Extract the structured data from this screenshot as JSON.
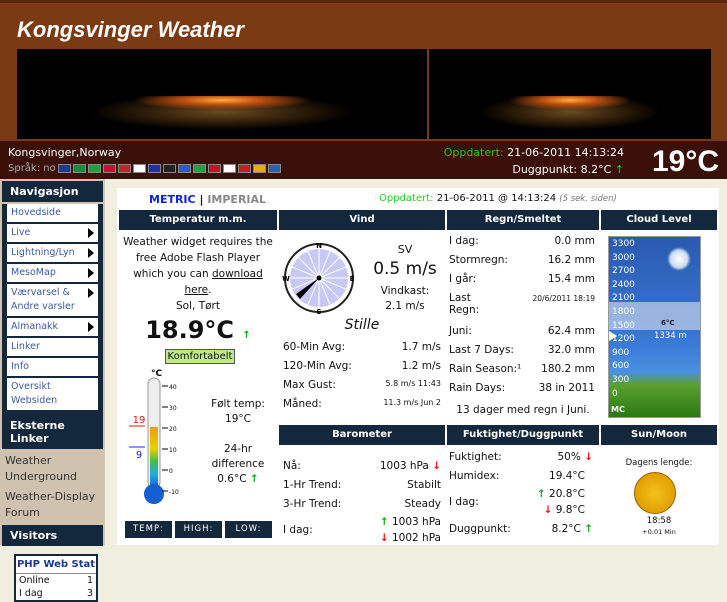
{
  "header": {
    "title": "Kongsvinger Weather",
    "location": "Kongsvinger,Norway",
    "language_label": "Språk: no",
    "updated_label": "Oppdatert:",
    "updated_value": "21-06-2011  14:13:24",
    "dewpoint_label": "Duggpunkt:",
    "dewpoint_value": "8.2°C",
    "big_temp": "19°C",
    "flags": [
      "gb",
      "za",
      "bg",
      "dk",
      "nl",
      "fi",
      "fr",
      "de",
      "gr",
      "it",
      "no",
      "pl",
      "pt",
      "es",
      "se"
    ]
  },
  "sidebar": {
    "nav_title": "Navigasjon",
    "items": [
      {
        "label": "Hovedside",
        "sub": false
      },
      {
        "label": "Live",
        "sub": true
      },
      {
        "label": "Lightning/Lyn",
        "sub": true
      },
      {
        "label": "MesoMap",
        "sub": true
      },
      {
        "label": "Værvarsel & Andre varsler",
        "sub": true
      },
      {
        "label": "Almanakk",
        "sub": true
      },
      {
        "label": "Linker",
        "sub": false
      },
      {
        "label": "Info",
        "sub": false
      },
      {
        "label": "Oversikt Websiden",
        "sub": false
      }
    ],
    "ext_title": "Eksterne Linker",
    "ext_links": [
      "Weather Underground",
      "Weather-Display Forum"
    ],
    "visitors_title": "Visitors",
    "stats": {
      "title": "PHP Web Stat",
      "rows": [
        {
          "label": "Online",
          "value": "1"
        },
        {
          "label": "I dag",
          "value": "3"
        }
      ]
    }
  },
  "main": {
    "metric": "METRIC",
    "sep": "|",
    "imperial": "IMPERIAL",
    "updated_label": "Oppdatert:",
    "updated_value": "21-06-2011 @ 14:13:24",
    "ago": "(5 sek. siden)",
    "temp": {
      "header": "Temperatur m.m.",
      "flash_1": "Weather widget requires the free Adobe Flash Player which you can ",
      "flash_link": "download here",
      "flash_end": ".",
      "condition": "Sol, Tørt",
      "value": "18.9°C",
      "comfort": "Komfortabelt",
      "unit": "°C",
      "scale": [
        "40",
        "30",
        "20",
        "10",
        "0",
        "-10"
      ],
      "high_mark": "19",
      "low_mark": "9",
      "feels_label": "Følt temp:",
      "feels_value": "19°C",
      "diff_label": "24-hr difference",
      "diff_value": "0.6°C",
      "buttons": [
        "TEMP:",
        "HIGH:",
        "LOW:"
      ]
    },
    "wind": {
      "header": "Vind",
      "dir": "SV",
      "speed": "0.5 m/s",
      "gust_label": "Vindkast:",
      "gust_value": "2.1 m/s",
      "desc": "Stille",
      "compass": [
        "N",
        "E",
        "S",
        "W"
      ],
      "rows": [
        {
          "label": "60-Min Avg:",
          "value": "1.7 m/s"
        },
        {
          "label": "120-Min Avg:",
          "value": "1.2 m/s"
        },
        {
          "label": "Max Gust:",
          "value": "5.8 m/s 11:43"
        },
        {
          "label": "Måned:",
          "value": "11.3 m/s Jun 2"
        }
      ]
    },
    "rain": {
      "header": "Regn/Smeltet",
      "rows": [
        {
          "label": "I dag:",
          "value": "0.0 mm"
        },
        {
          "label": "Stormregn:",
          "value": "16.2 mm"
        },
        {
          "label": "I går:",
          "value": "15.4 mm"
        },
        {
          "label": "Last Regn:",
          "value": "20/6/2011 18:19"
        },
        {
          "label": "Juni:",
          "value": "62.4 mm"
        },
        {
          "label": "Last 7 Days:",
          "value": "32.0 mm"
        },
        {
          "label": "Rain Season:¹",
          "value": "180.2 mm"
        },
        {
          "label": "Rain Days:",
          "value": "38 in 2011"
        }
      ],
      "note": "13 dager med regn i Juni."
    },
    "cloud": {
      "header": "Cloud Level",
      "scale": [
        "3300",
        "3000",
        "2700",
        "2400",
        "2100",
        "1800",
        "1500",
        "1200",
        "900",
        "600",
        "300",
        "0"
      ],
      "temp": "6°C",
      "height": "1334 m",
      "logo": "MC"
    },
    "baro": {
      "header": "Barometer",
      "rows": [
        {
          "label": "Nå:",
          "value": "1003 hPa",
          "trend": "down"
        },
        {
          "label": "1-Hr Trend:",
          "value": "Stabilt"
        },
        {
          "label": "3-Hr Trend:",
          "value": "Steady"
        }
      ],
      "today_label": "I dag:",
      "today_high": "1003 hPa",
      "today_low": "1002 hPa"
    },
    "hum": {
      "header": "Fuktighet/Duggpunkt",
      "rows": [
        {
          "label": "Fuktighet:",
          "value": "50%"
        },
        {
          "label": "Humidex:",
          "value": "19.4°C"
        }
      ],
      "today_label": "I dag:",
      "today_high": "20.8°C",
      "today_low": "9.8°C",
      "dew_label": "Duggpunkt:",
      "dew_value": "8.2°C"
    },
    "sun": {
      "header": "Sun/Moon",
      "day_label": "Dagens lengde:",
      "day_length": "18:58",
      "change": "+0:01 Min"
    }
  },
  "colors": {
    "header_bg": "#7a3a14",
    "infobar_bg": "#3a1008",
    "panel_head": "#13283c",
    "sidebar_bg": "#cfc3b0",
    "up": "#11aa11",
    "down": "#ee1111"
  }
}
